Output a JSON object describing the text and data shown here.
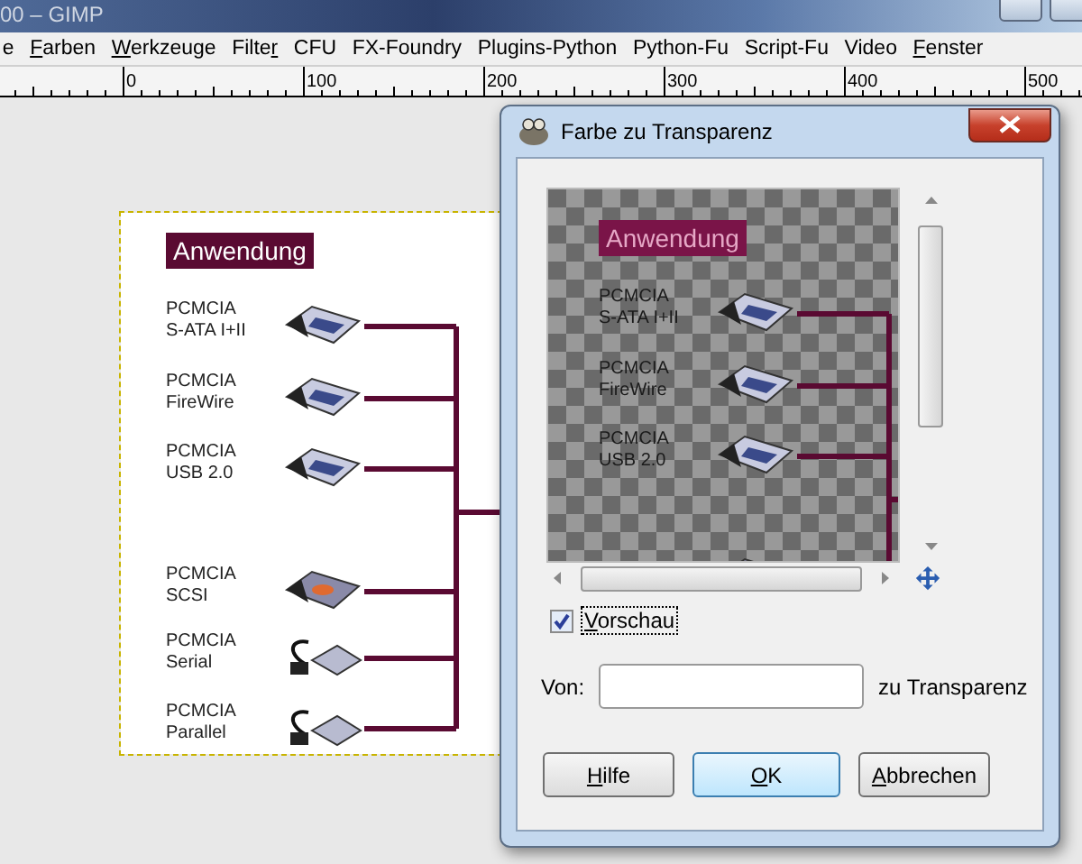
{
  "window": {
    "title": "00 – GIMP"
  },
  "menu": [
    {
      "pre": "e"
    },
    {
      "key": "F",
      "post": "arben"
    },
    {
      "key": "W",
      "post": "erkzeuge"
    },
    {
      "pre": "Filte",
      "key": "r"
    },
    {
      "pre": "CFU"
    },
    {
      "pre": "FX-Foundry"
    },
    {
      "pre": "Plugins-Python"
    },
    {
      "pre": "Python-Fu"
    },
    {
      "pre": "Script-Fu"
    },
    {
      "pre": "Video"
    },
    {
      "key": "F",
      "post": "enster"
    }
  ],
  "ruler": {
    "labels": [
      "0",
      "100",
      "200",
      "300",
      "400",
      "500"
    ]
  },
  "image": {
    "heading": "Anwendung",
    "items": [
      {
        "line1": "PCMCIA",
        "line2": "S-ATA I+II",
        "kind": "card"
      },
      {
        "line1": "PCMCIA",
        "line2": "FireWire",
        "kind": "card"
      },
      {
        "line1": "PCMCIA",
        "line2": "USB 2.0",
        "kind": "card"
      },
      {
        "line1": "PCMCIA",
        "line2": "SCSI",
        "kind": "scsi"
      },
      {
        "line1": "PCMCIA",
        "line2": "Serial",
        "kind": "cable"
      },
      {
        "line1": "PCMCIA",
        "line2": "Parallel",
        "kind": "cable"
      }
    ]
  },
  "dialog": {
    "title": "Farbe zu Transparenz",
    "preview": {
      "heading": "Anwendung",
      "items": [
        {
          "line1": "PCMCIA",
          "line2": "S-ATA I+II",
          "kind": "card"
        },
        {
          "line1": "PCMCIA",
          "line2": "FireWire",
          "kind": "card"
        },
        {
          "line1": "PCMCIA",
          "line2": "USB 2.0",
          "kind": "card"
        },
        {
          "kind": "scsi"
        }
      ]
    },
    "preview_toggle": {
      "key": "V",
      "post": "orschau",
      "checked": true
    },
    "from": {
      "label": "Von:",
      "suffix": "zu Transparenz"
    },
    "buttons": [
      {
        "key": "H",
        "post": "ilfe",
        "default": false
      },
      {
        "key": "O",
        "post": "K",
        "default": true
      },
      {
        "key": "A",
        "post": "bbrechen",
        "default": false
      }
    ]
  }
}
